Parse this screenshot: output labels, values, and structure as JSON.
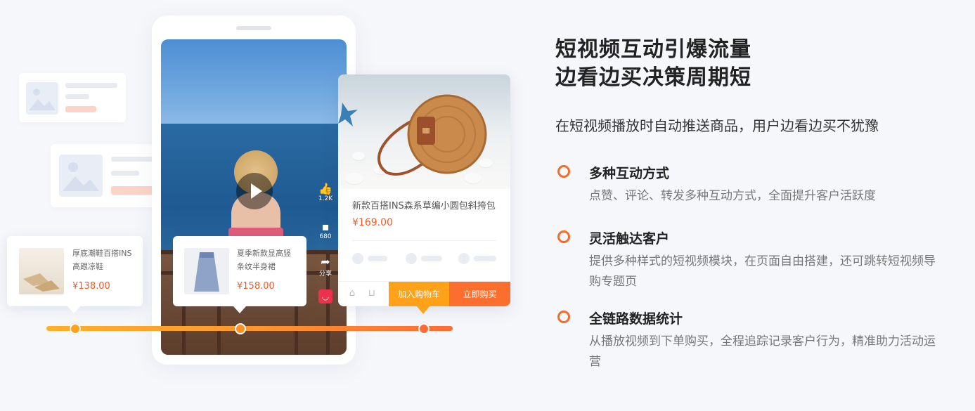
{
  "headline": {
    "line1": "短视频互动引爆流量",
    "line2": "边看边买决策周期短"
  },
  "subheadline": "在短视频播放时自动推送商品，用户边看边买不犹豫",
  "features": [
    {
      "title": "多种互动方式",
      "desc": "点赞、评论、转发多种互动方式，全面提升客户活跃度"
    },
    {
      "title": "灵活触达客户",
      "desc": "提供多种样式的短视频模块，在页面自由搭建，还可跳转短视频导购专题页"
    },
    {
      "title": "全链路数据统计",
      "desc": "从播放视频到下单购买，全程追踪记录客户行为，精准助力活动运营"
    }
  ],
  "video": {
    "like_count": "1.2K",
    "comment_count": "680",
    "share_label": "分享",
    "icons": [
      "thumbs-up-icon",
      "comment-icon",
      "share-icon",
      "shopping-bag-icon",
      "play-icon"
    ]
  },
  "product_popup": {
    "title": "新款百搭INS森系草编小圆包斜挎包",
    "price": "¥169.00",
    "add_to_cart": "加入购物车",
    "buy_now": "立即购买"
  },
  "tags": [
    {
      "name_line1": "厚底潮鞋百搭INS",
      "name_line2": "高跟凉鞋",
      "price": "¥138.00"
    },
    {
      "name_line1": "夏季新款显高竖",
      "name_line2": "条纹半身裙",
      "price": "¥158.00"
    }
  ],
  "colors": {
    "accent_orange": "#fb6e2e",
    "accent_yellow": "#ffa21a",
    "price_red": "#f05a24"
  }
}
